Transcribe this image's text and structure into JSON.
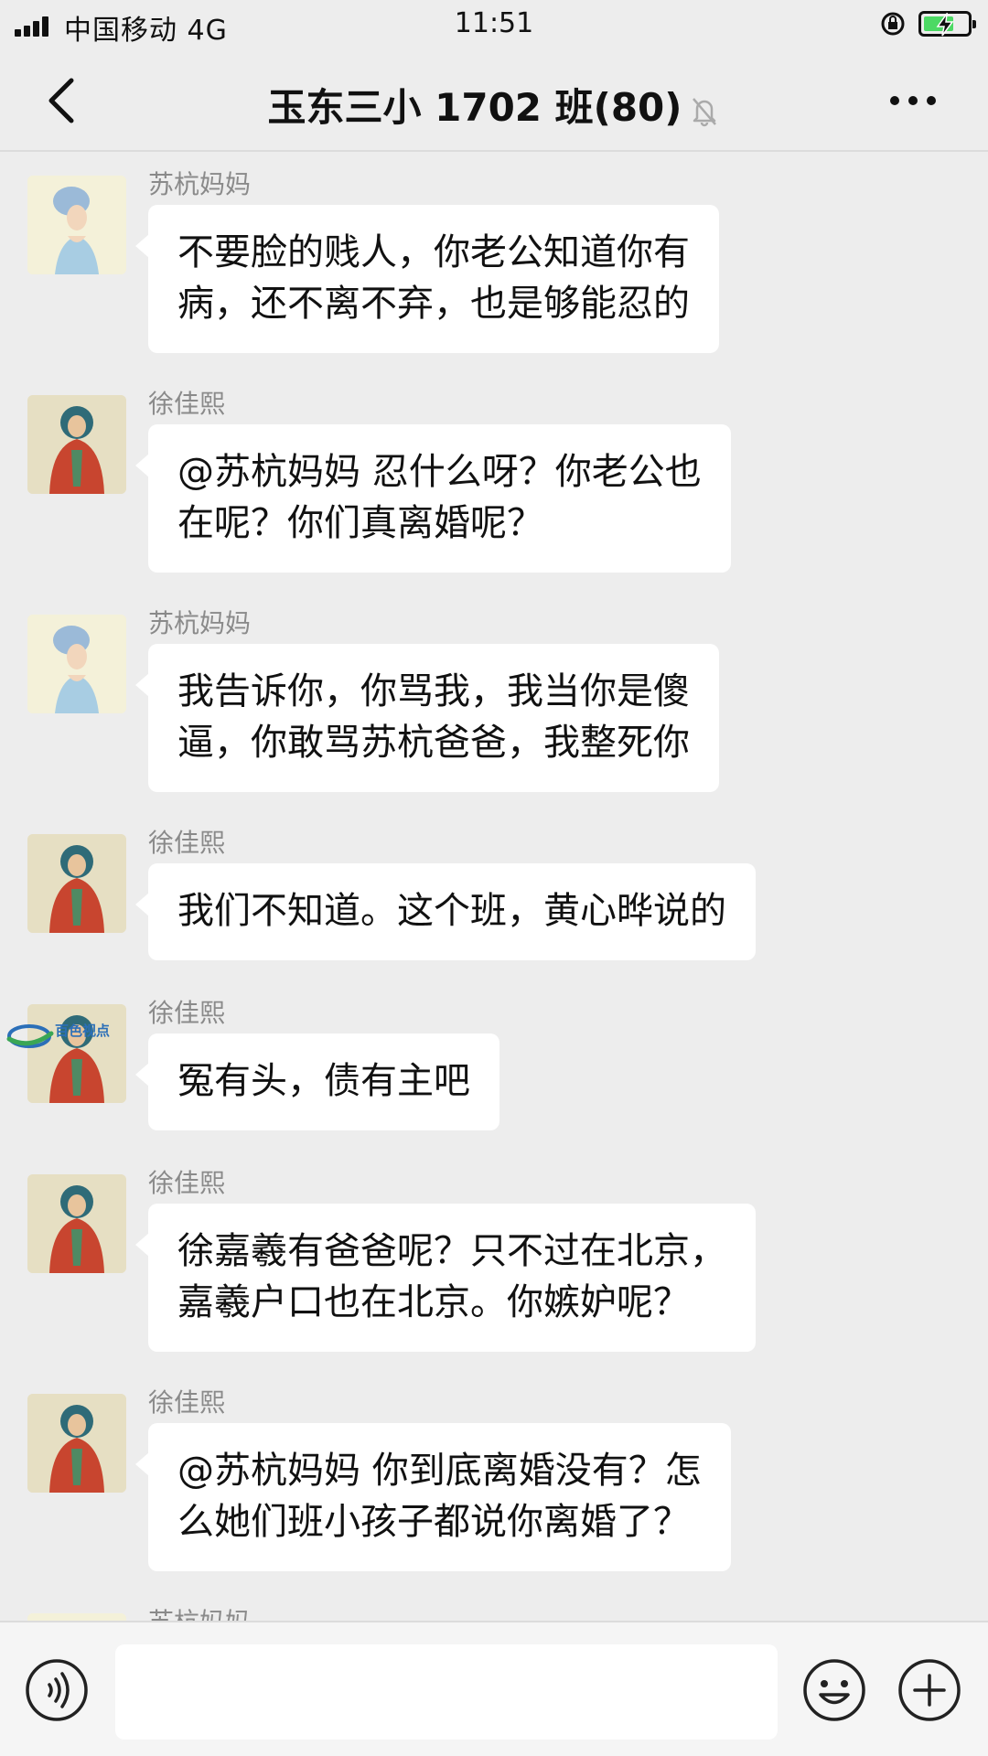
{
  "status_bar": {
    "carrier": "中国移动 4G",
    "time": "11:51",
    "battery_level": 0.7
  },
  "header": {
    "back_icon": "chevron-left-icon",
    "title": "玉东三小 1702 班(80)",
    "mute_icon": "bell-muted-icon",
    "more_icon": "more-dots-icon"
  },
  "messages": [
    {
      "sender": "苏杭妈妈",
      "avatar": "lady",
      "lines": [
        "不要脸的贱人，你老公知道你有",
        "病，还不离不弃，也是够能忍的"
      ]
    },
    {
      "sender": "徐佳熙",
      "avatar": "monk",
      "lines": [
        "@苏杭妈妈 忍什么呀？你老公也",
        "在呢？你们真离婚呢？"
      ]
    },
    {
      "sender": "苏杭妈妈",
      "avatar": "lady",
      "lines": [
        "我告诉你，你骂我，我当你是傻",
        "逼，你敢骂苏杭爸爸，我整死你"
      ]
    },
    {
      "sender": "徐佳熙",
      "avatar": "monk",
      "lines": [
        "我们不知道。这个班，黄心晔说的"
      ]
    },
    {
      "sender": "徐佳熙",
      "avatar": "monk",
      "lines": [
        "冤有头，债有主吧"
      ]
    },
    {
      "sender": "徐佳熙",
      "avatar": "monk",
      "lines": [
        "徐嘉羲有爸爸呢？只不过在北京，",
        "嘉羲户口也在北京。你嫉妒呢？"
      ]
    },
    {
      "sender": "徐佳熙",
      "avatar": "monk",
      "lines": [
        "@苏杭妈妈 你到底离婚没有？怎",
        "么她们班小孩子都说你离婚了？"
      ]
    },
    {
      "sender": "苏杭妈妈",
      "avatar": "lady",
      "lines": []
    }
  ],
  "watermark": {
    "text": "百色视点"
  },
  "input_bar": {
    "voice_icon": "voice-icon",
    "input_value": "",
    "emoji_icon": "emoji-icon",
    "plus_icon": "plus-icon"
  }
}
